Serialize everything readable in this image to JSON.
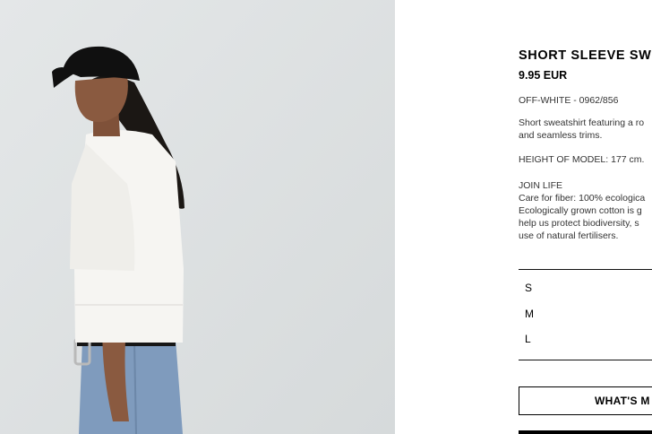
{
  "product": {
    "title": "SHORT SLEEVE SW",
    "price": "9.95 EUR",
    "color_ref": "OFF-WHITE - 0962/856",
    "description_lines": [
      "Short sweatshirt featuring a ro",
      "and seamless trims."
    ],
    "model_height": "HEIGHT OF MODEL: 177 cm.",
    "join_life": {
      "heading": "JOIN LIFE",
      "lines": [
        "Care for fiber: 100% ecologica",
        "Ecologically grown cotton is g",
        "help us protect biodiversity, s",
        "use of natural fertilisers."
      ]
    }
  },
  "sizes": [
    "S",
    "M",
    "L"
  ],
  "buttons": {
    "whats_my_size": "WHAT'S M"
  },
  "colors": {
    "photo_background": "#dde1e2",
    "text": "#000000",
    "secondary_text": "#333333"
  }
}
